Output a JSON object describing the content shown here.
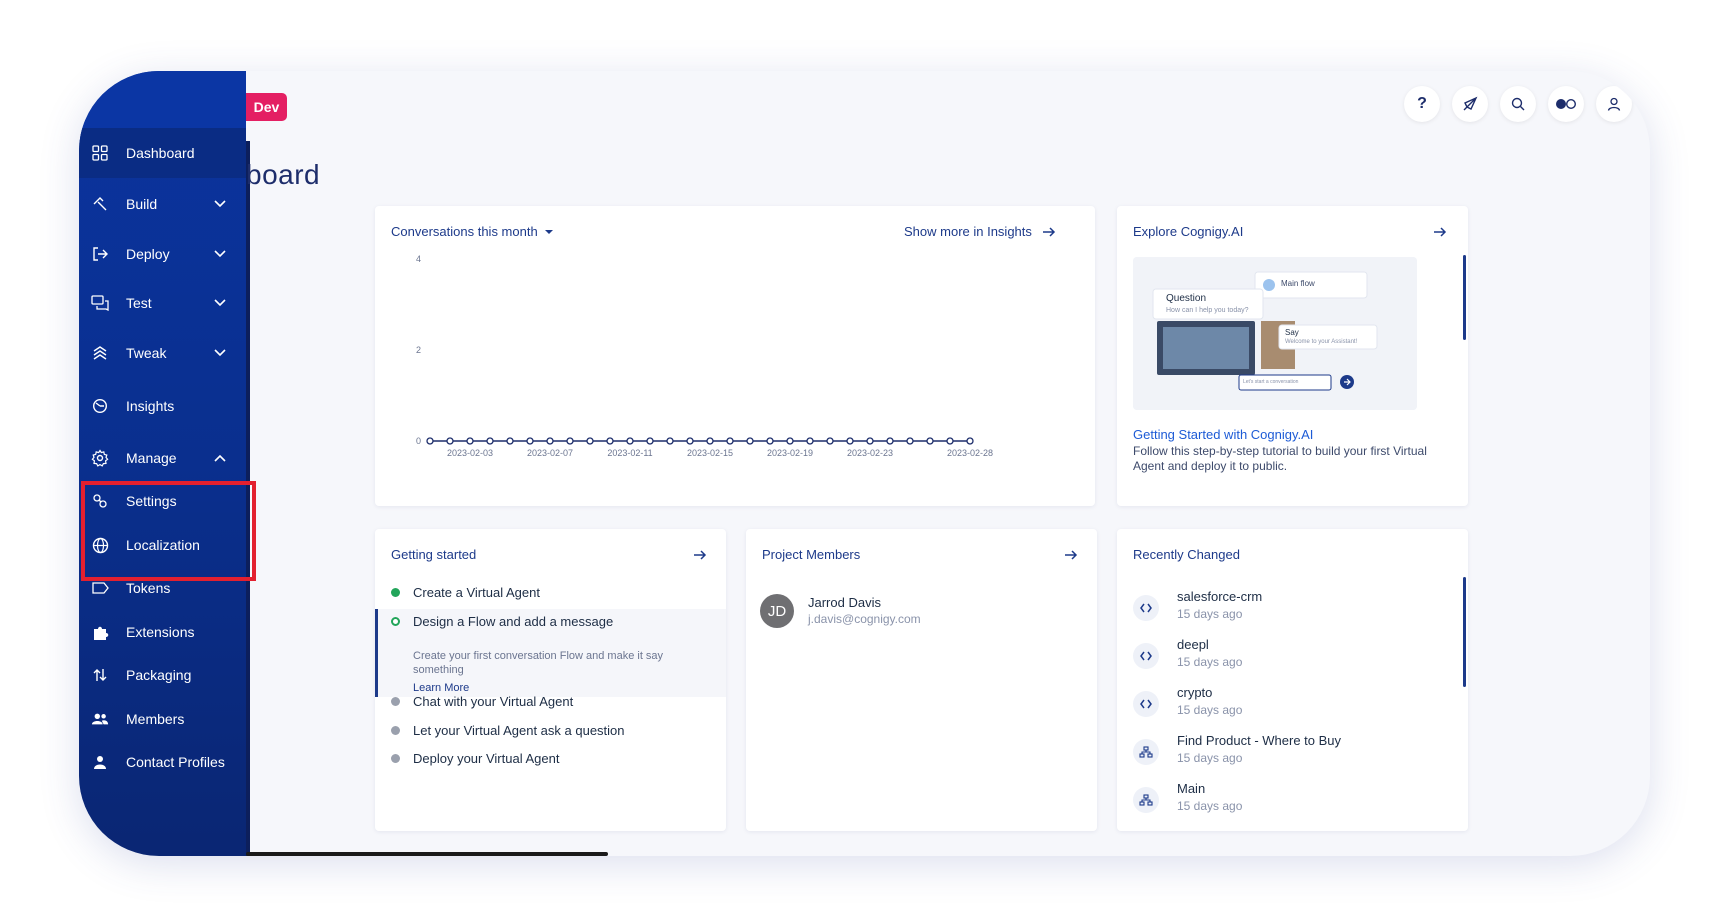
{
  "env_badge": "Dev",
  "page_title": "board",
  "sidebar": {
    "items": [
      {
        "label": "Dashboard",
        "icon": "grid-icon",
        "active": true,
        "chevron": ""
      },
      {
        "label": "Build",
        "icon": "build-icon",
        "chevron": "down"
      },
      {
        "label": "Deploy",
        "icon": "deploy-icon",
        "chevron": "down"
      },
      {
        "label": "Test",
        "icon": "chat-icon",
        "chevron": "down"
      },
      {
        "label": "Tweak",
        "icon": "layers-icon",
        "chevron": "down"
      },
      {
        "label": "Insights",
        "icon": "insights-icon",
        "chevron": ""
      },
      {
        "label": "Manage",
        "icon": "gear-icon",
        "chevron": "up"
      },
      {
        "label": "Settings",
        "icon": "settings-icon",
        "chevron": ""
      },
      {
        "label": "Localization",
        "icon": "globe-icon",
        "chevron": ""
      },
      {
        "label": "Tokens",
        "icon": "token-icon",
        "chevron": ""
      },
      {
        "label": "Extensions",
        "icon": "puzzle-icon",
        "chevron": ""
      },
      {
        "label": "Packaging",
        "icon": "packaging-icon",
        "chevron": ""
      },
      {
        "label": "Members",
        "icon": "members-icon",
        "chevron": ""
      },
      {
        "label": "Contact Profiles",
        "icon": "contact-icon",
        "chevron": ""
      }
    ]
  },
  "topbar": {
    "icons": [
      "help-icon",
      "compass-icon",
      "search-icon",
      "toggle-icon",
      "user-icon"
    ],
    "help_glyph": "?"
  },
  "conversations": {
    "title": "Conversations this month",
    "show_more": "Show more in Insights",
    "chart_data": {
      "type": "line",
      "x": [
        "2023-02-01",
        "2023-02-02",
        "2023-02-03",
        "2023-02-04",
        "2023-02-05",
        "2023-02-06",
        "2023-02-07",
        "2023-02-08",
        "2023-02-09",
        "2023-02-10",
        "2023-02-11",
        "2023-02-12",
        "2023-02-13",
        "2023-02-14",
        "2023-02-15",
        "2023-02-16",
        "2023-02-17",
        "2023-02-18",
        "2023-02-19",
        "2023-02-20",
        "2023-02-21",
        "2023-02-22",
        "2023-02-23",
        "2023-02-24",
        "2023-02-25",
        "2023-02-26",
        "2023-02-27",
        "2023-02-28"
      ],
      "values": [
        0,
        0,
        0,
        0,
        0,
        0,
        0,
        0,
        0,
        0,
        0,
        0,
        0,
        0,
        0,
        0,
        0,
        0,
        0,
        0,
        0,
        0,
        0,
        0,
        0,
        0,
        0,
        0
      ],
      "x_ticks": [
        "2023-02-03",
        "2023-02-07",
        "2023-02-11",
        "2023-02-15",
        "2023-02-19",
        "2023-02-23",
        "2023-02-28"
      ],
      "y_ticks": [
        "0",
        "2",
        "4"
      ],
      "ylim": [
        0,
        4
      ]
    }
  },
  "explore": {
    "title": "Explore Cognigy.AI",
    "link": "Getting Started with Cognigy.AI",
    "description": "Follow this step-by-step tutorial to build your first Virtual Agent and deploy it to public.",
    "illustration": {
      "main_flow": "Main flow",
      "question": "Question",
      "question_sub": "How can I help you today?",
      "say": "Say",
      "say_sub": "Welcome to your Assistant!",
      "input_placeholder": "Let's start a conversation"
    }
  },
  "getting_started": {
    "title": "Getting started",
    "steps": [
      {
        "label": "Create a Virtual Agent",
        "status": "done"
      },
      {
        "label": "Design a Flow and add a message",
        "status": "active"
      },
      {
        "label": "Chat with your Virtual Agent",
        "status": "todo"
      },
      {
        "label": "Let your Virtual Agent ask a question",
        "status": "todo"
      },
      {
        "label": "Deploy your Virtual Agent",
        "status": "todo"
      }
    ],
    "active_desc": "Create your first conversation Flow and make it say something",
    "learn_more": "Learn More"
  },
  "members": {
    "title": "Project Members",
    "list": [
      {
        "initials": "JD",
        "name": "Jarrod Davis",
        "email": "j.davis@cognigy.com"
      }
    ]
  },
  "recent": {
    "title": "Recently Changed",
    "items": [
      {
        "name": "salesforce-crm",
        "time": "15 days ago",
        "icon": "code-icon"
      },
      {
        "name": "deepl",
        "time": "15 days ago",
        "icon": "code-icon"
      },
      {
        "name": "crypto",
        "time": "15 days ago",
        "icon": "code-icon"
      },
      {
        "name": "Find Product - Where to Buy",
        "time": "15 days ago",
        "icon": "flow-icon"
      },
      {
        "name": "Main",
        "time": "15 days ago",
        "icon": "flow-icon"
      }
    ]
  }
}
